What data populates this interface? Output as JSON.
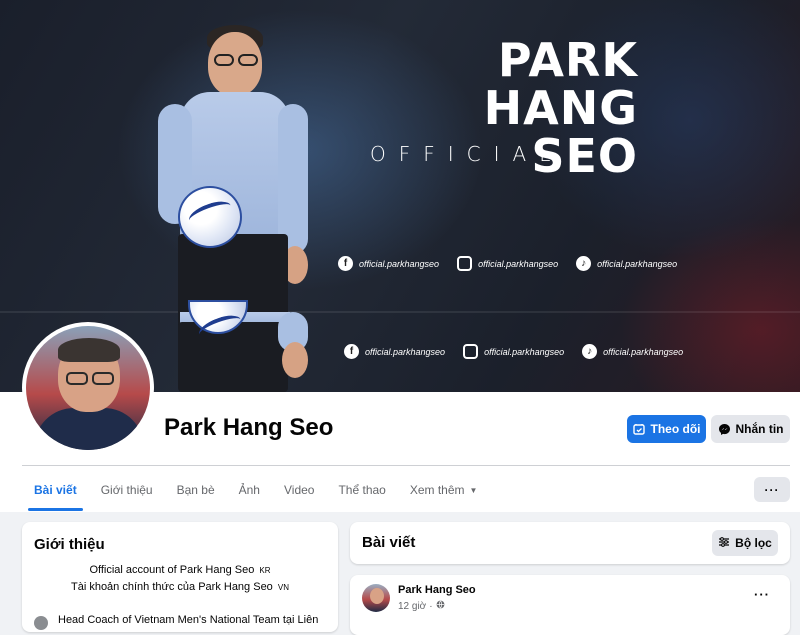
{
  "cover": {
    "title_line1": "PARK",
    "title_line2": "HANG SEO",
    "subtitle": "OFFICIAL",
    "socials": [
      {
        "icon": "facebook-icon",
        "glyph": "f",
        "handle": "official.parkhangseo"
      },
      {
        "icon": "instagram-icon",
        "glyph": "◎",
        "handle": "official.parkhangseo"
      },
      {
        "icon": "tiktok-icon",
        "glyph": "♪",
        "handle": "official.parkhangseo"
      }
    ]
  },
  "profile": {
    "name": "Park Hang Seo",
    "follow_label": "Theo dõi",
    "message_label": "Nhắn tin"
  },
  "tabs": [
    {
      "label": "Bài viết",
      "active": true
    },
    {
      "label": "Giới thiệu"
    },
    {
      "label": "Bạn bè"
    },
    {
      "label": "Ảnh"
    },
    {
      "label": "Video"
    },
    {
      "label": "Thể thao"
    },
    {
      "label": "Xem thêm",
      "caret": "▼"
    }
  ],
  "more_label": "···",
  "intro": {
    "title": "Giới thiệu",
    "bio_line1": "Official account of Park Hang Seo",
    "bio_line1_flag": "KR",
    "bio_line2": "Tài khoản chính thức của Park Hang Seo",
    "bio_line2_flag": "VN",
    "detail": "Head Coach of Vietnam Men's National Team tại Liên"
  },
  "posts": {
    "title": "Bài viết",
    "filter_label": "Bộ lọc",
    "first_post": {
      "author": "Park Hang Seo",
      "time": "12 giờ",
      "separator": "·",
      "privacy_icon": "globe-icon",
      "more": "···"
    }
  },
  "colors": {
    "accent": "#1b74e4",
    "secondary_button": "#e4e6eb",
    "page_bg": "#f0f2f5"
  }
}
